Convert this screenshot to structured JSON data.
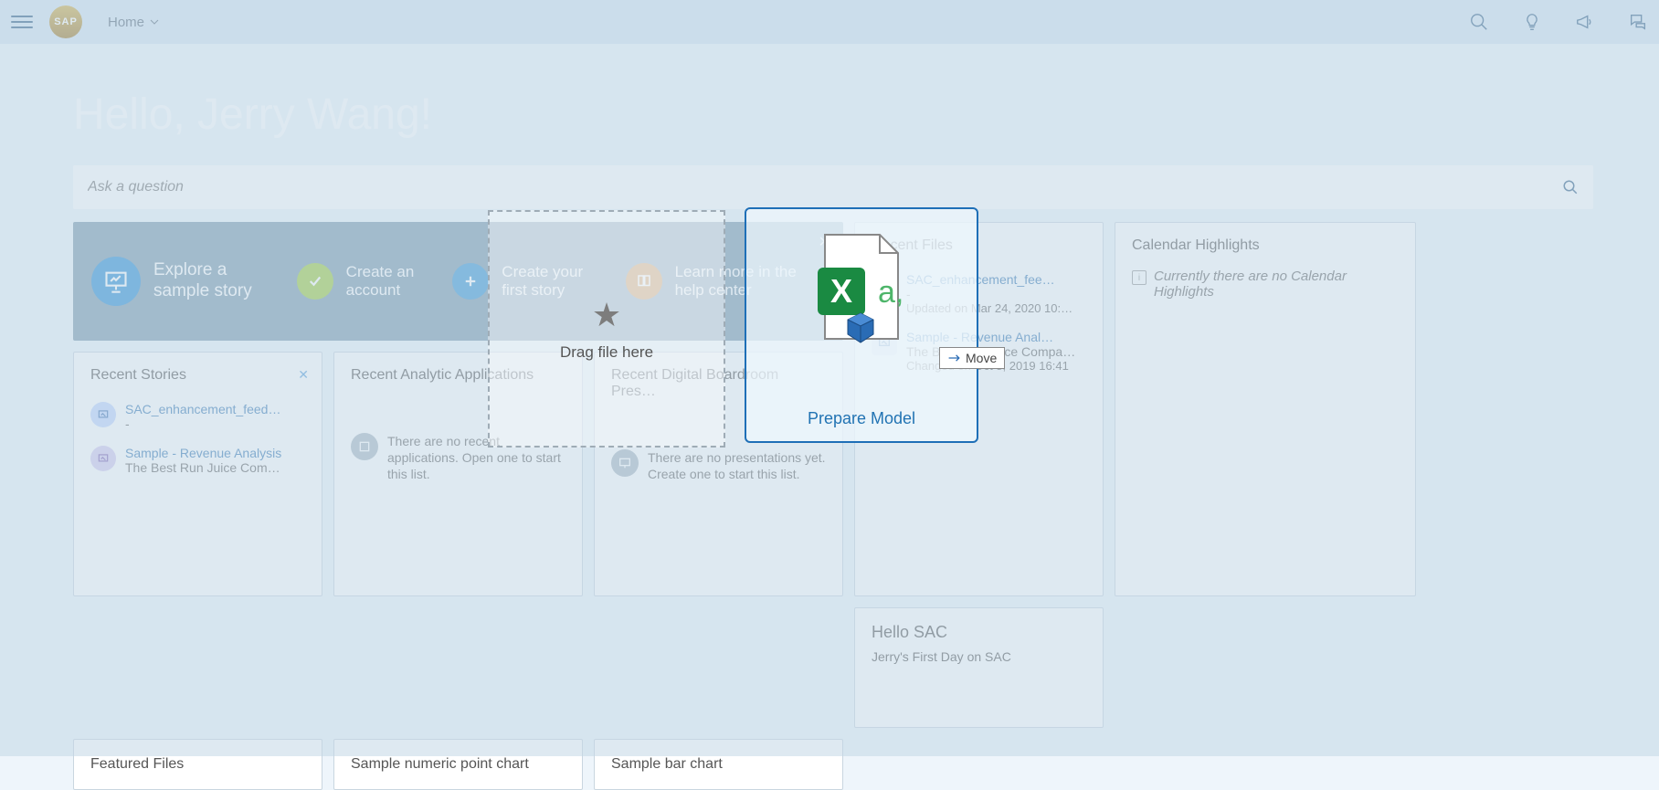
{
  "header": {
    "home_label": "Home"
  },
  "greeting": "Hello, Jerry Wang!",
  "search": {
    "placeholder": "Ask a question"
  },
  "getting_started": {
    "explore": "Explore a sample story",
    "account": "Create an account",
    "story": "Create your first story",
    "learn": "Learn more in the help center"
  },
  "stories": {
    "title": "Recent Stories",
    "items": [
      {
        "title": "SAC_enhancement_feed…",
        "sub": "-"
      },
      {
        "title": "Sample - Revenue Analysis",
        "sub": "The Best Run Juice Com…"
      }
    ]
  },
  "apps": {
    "title": "Recent Analytic Applications",
    "empty": "There are no recent applications. Open one to start this list."
  },
  "pres": {
    "title": "Recent Digital Boardroom Pres…",
    "empty": "There are no presentations yet. Create one to start this list."
  },
  "files": {
    "title": "Recent Files",
    "items": [
      {
        "title": "SAC_enhancement_fee…",
        "sub": "-",
        "date": "Updated on Mar 24, 2020 10:…"
      },
      {
        "title": "Sample - Revenue Anal…",
        "sub": "The Best Run Juice Compa…",
        "date": "Changed on Oct 8, 2019 16:41"
      }
    ]
  },
  "calendar": {
    "title": "Calendar Highlights",
    "empty": "Currently there are no Calendar Highlights"
  },
  "hello_sac": {
    "title": "Hello SAC",
    "sub": "Jerry's First Day on SAC"
  },
  "featured": {
    "title": "Featured Files"
  },
  "numeric": {
    "title": "Sample numeric point chart"
  },
  "bar": {
    "title": "Sample bar chart"
  },
  "drop": {
    "label": "Drag file here"
  },
  "prep": {
    "label": "Prepare Model",
    "move": "Move"
  }
}
